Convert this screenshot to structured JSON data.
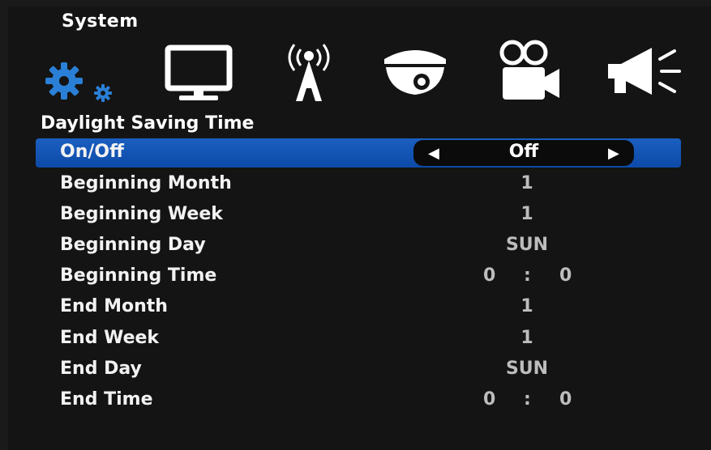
{
  "menu": {
    "title": "System",
    "icons": [
      "gears-icon",
      "monitor-icon",
      "antenna-icon",
      "dome-camera-icon",
      "video-camera-icon",
      "megaphone-icon"
    ]
  },
  "section": {
    "title": "Daylight Saving Time"
  },
  "colors": {
    "highlight": "#1458b8",
    "accent_blue": "#2a7fd6"
  },
  "rows": [
    {
      "label": "On/Off",
      "value": "Off"
    },
    {
      "label": "Beginning Month",
      "value": "1"
    },
    {
      "label": "Beginning Week",
      "value": "1"
    },
    {
      "label": "Beginning Day",
      "value": "SUN"
    },
    {
      "label": "Beginning Time",
      "hour": "0",
      "sep": ":",
      "minute": "0"
    },
    {
      "label": "End Month",
      "value": "1"
    },
    {
      "label": "End Week",
      "value": "1"
    },
    {
      "label": "End Day",
      "value": "SUN"
    },
    {
      "label": "End Time",
      "hour": "0",
      "sep": ":",
      "minute": "0"
    }
  ]
}
